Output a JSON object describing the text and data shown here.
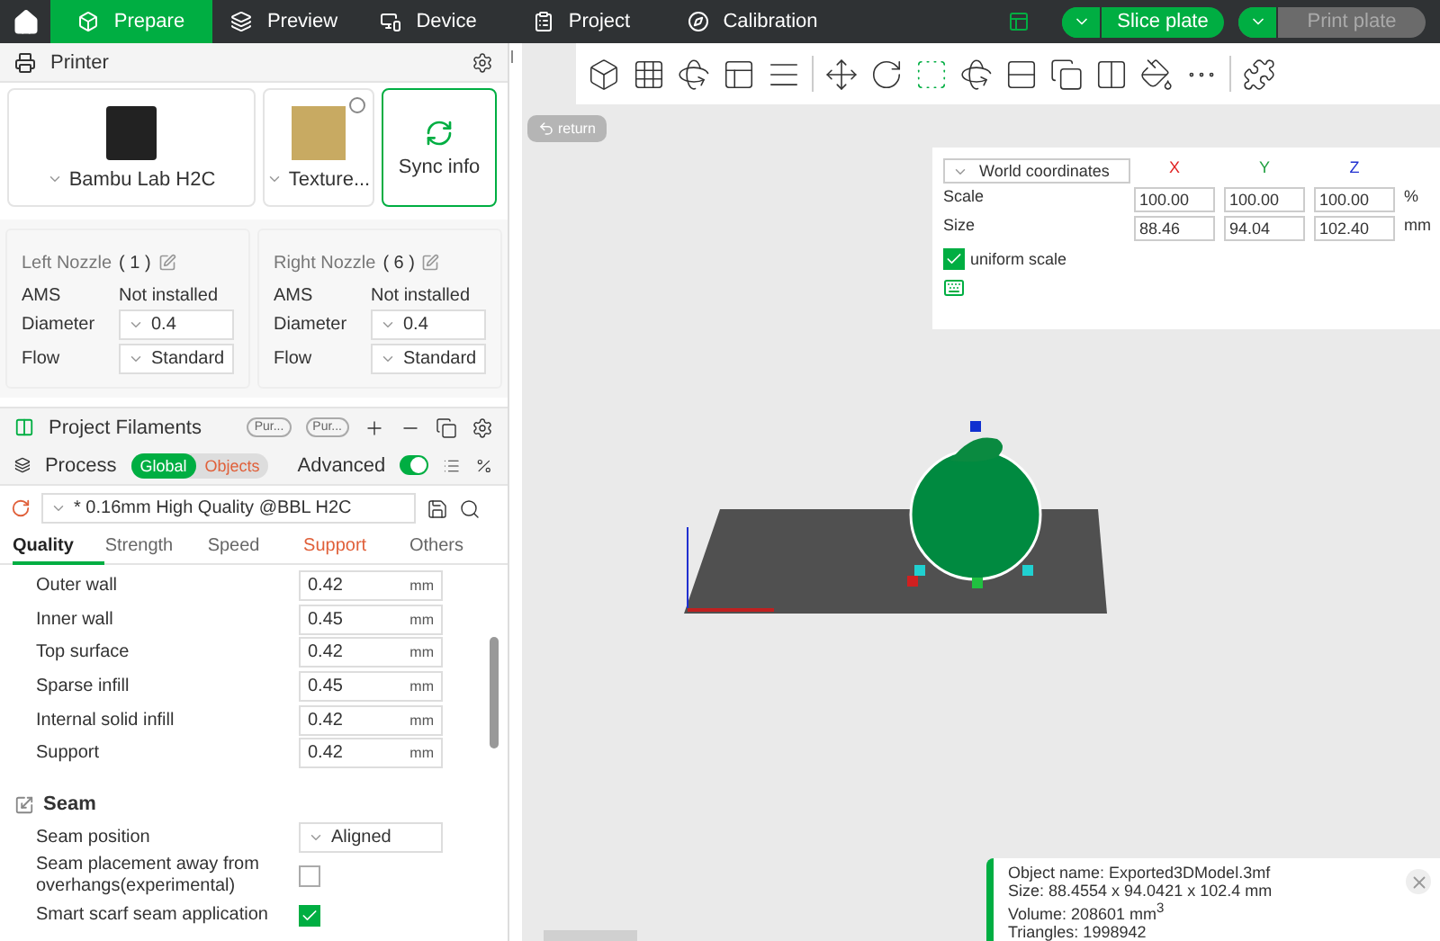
{
  "nav": {
    "tabs": [
      {
        "label": "Prepare",
        "selected": true
      },
      {
        "label": "Preview",
        "selected": false
      },
      {
        "label": "Device",
        "selected": false
      },
      {
        "label": "Project",
        "selected": false
      },
      {
        "label": "Calibration",
        "selected": false
      }
    ],
    "slice_button": "Slice plate",
    "print_button": {
      "label": "Print plate",
      "disabled": true
    }
  },
  "printer": {
    "title": "Printer",
    "name": "Bambu Lab H2C",
    "plate": "Texture...",
    "sync": "Sync info"
  },
  "nozzles": [
    {
      "title": "Left Nozzle",
      "count": "( 1 )",
      "ams_label": "AMS",
      "ams_value": "Not installed",
      "diameter_label": "Diameter",
      "diameter": "0.4",
      "flow_label": "Flow",
      "flow": "Standard"
    },
    {
      "title": "Right Nozzle",
      "count": "( 6 )",
      "ams_label": "AMS",
      "ams_value": "Not installed",
      "diameter_label": "Diameter",
      "diameter": "0.4",
      "flow_label": "Flow",
      "flow": "Standard"
    }
  ],
  "filaments": {
    "title": "Project Filaments",
    "chips": [
      "Pur...",
      "Pur..."
    ]
  },
  "process": {
    "title": "Process",
    "modes": [
      {
        "label": "Global",
        "selected": true
      },
      {
        "label": "Objects",
        "selected": false
      }
    ],
    "advanced": {
      "label": "Advanced",
      "on": true
    },
    "preset": "* 0.16mm High Quality @BBL H2C",
    "tabs": [
      {
        "label": "Quality",
        "selected": true,
        "modified": false
      },
      {
        "label": "Strength",
        "selected": false,
        "modified": false
      },
      {
        "label": "Speed",
        "selected": false,
        "modified": false
      },
      {
        "label": "Support",
        "selected": false,
        "modified": true
      },
      {
        "label": "Others",
        "selected": false,
        "modified": false
      }
    ],
    "rows": [
      {
        "label": "Outer wall",
        "value": "0.42",
        "unit": "mm"
      },
      {
        "label": "Inner wall",
        "value": "0.45",
        "unit": "mm"
      },
      {
        "label": "Top surface",
        "value": "0.42",
        "unit": "mm"
      },
      {
        "label": "Sparse infill",
        "value": "0.45",
        "unit": "mm"
      },
      {
        "label": "Internal solid infill",
        "value": "0.42",
        "unit": "mm"
      },
      {
        "label": "Support",
        "value": "0.42",
        "unit": "mm"
      }
    ],
    "seam": {
      "title": "Seam",
      "rows": [
        {
          "kind": "dropdown",
          "label": "Seam position",
          "value": "Aligned"
        },
        {
          "kind": "checkbox",
          "label": "Seam placement away from overhangs(experimental)",
          "checked": false
        },
        {
          "kind": "checkbox",
          "label": "Smart scarf seam application",
          "checked": true
        }
      ]
    }
  },
  "viewport": {
    "return_label": "return",
    "coords": {
      "frame": "World coordinates",
      "axes": [
        {
          "label": "X",
          "color": "#e02020"
        },
        {
          "label": "Y",
          "color": "#20a040"
        },
        {
          "label": "Z",
          "color": "#2030d0"
        }
      ],
      "rows": [
        {
          "label": "Scale",
          "values": [
            "100.00",
            "100.00",
            "100.00"
          ],
          "unit": "%"
        },
        {
          "label": "Size",
          "values": [
            "88.46",
            "94.04",
            "102.40"
          ],
          "unit": "mm"
        }
      ],
      "uniform": {
        "label": "uniform scale",
        "checked": true
      }
    },
    "object_info": [
      "Object name: Exported3DModel.3mf",
      "Size: 88.4554 x 94.0421 x 102.4 mm",
      "Volume: 208601 mm$^{3}$",
      "Triangles: 1998942"
    ]
  }
}
